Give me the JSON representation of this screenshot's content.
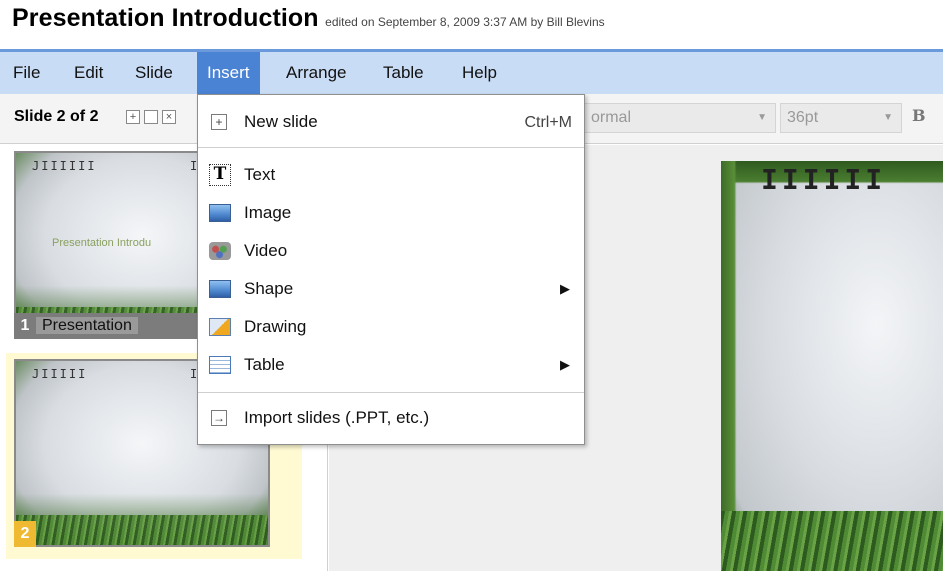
{
  "header": {
    "title": "Presentation Introduction",
    "meta": "edited on September 8, 2009 3:37 AM by Bill Blevins"
  },
  "menubar": {
    "items": [
      {
        "label": "File"
      },
      {
        "label": "Edit"
      },
      {
        "label": "Slide"
      },
      {
        "label": "Insert",
        "active": true
      },
      {
        "label": "Arrange"
      },
      {
        "label": "Table"
      },
      {
        "label": "Help"
      }
    ]
  },
  "toolbar": {
    "slide_counter": "Slide 2 of 2",
    "style_select": "ormal",
    "size_select": "36pt",
    "bold_label": "B"
  },
  "insert_menu": {
    "items": [
      {
        "label": "New slide",
        "shortcut": "Ctrl+M",
        "icon": "new-slide-icon"
      },
      {
        "label": "Text",
        "icon": "text-icon"
      },
      {
        "label": "Image",
        "icon": "image-icon"
      },
      {
        "label": "Video",
        "icon": "video-icon"
      },
      {
        "label": "Shape",
        "icon": "shape-icon",
        "has_submenu": true,
        "submenu_arrow": "▶"
      },
      {
        "label": "Drawing",
        "icon": "drawing-icon"
      },
      {
        "label": "Table",
        "icon": "table-icon",
        "has_submenu": true,
        "submenu_arrow": "▶"
      },
      {
        "label": "Import slides (.PPT, etc.)",
        "icon": "import-icon"
      }
    ]
  },
  "slides": [
    {
      "number": "1",
      "caption": "Presentation",
      "thumb_text": "Presentation Introdu"
    },
    {
      "number": "2",
      "caption": "",
      "selected": true
    }
  ],
  "colors": {
    "menubar_bg": "#c9dcf5",
    "menu_active": "#4a82d4",
    "selected_slide_bg": "#fffad2",
    "slide_badge": "#f0b932"
  }
}
